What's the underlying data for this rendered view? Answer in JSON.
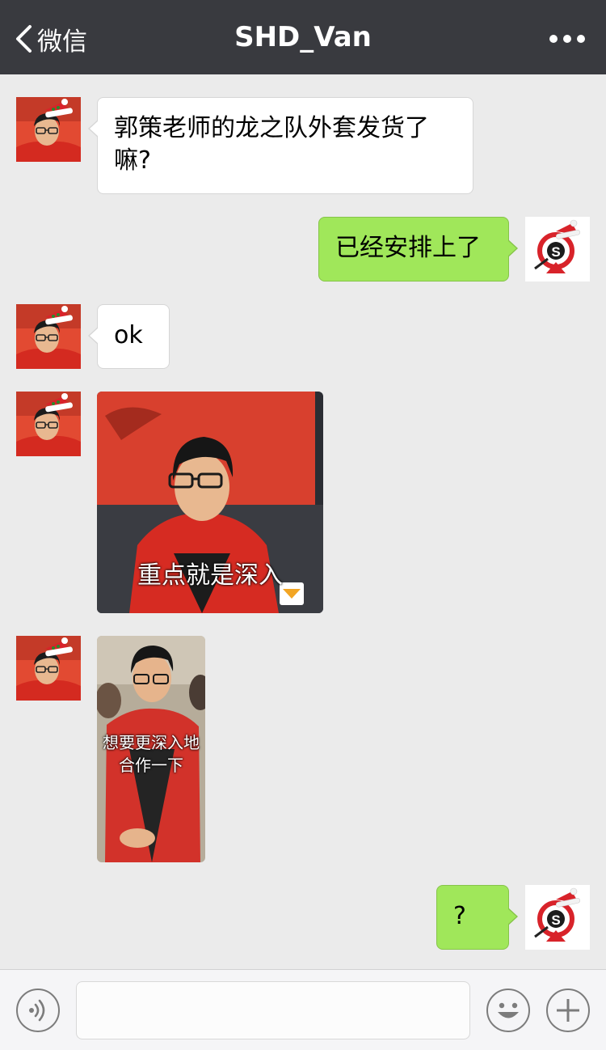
{
  "header": {
    "back_label": "微信",
    "title": "SHD_Van",
    "more_icon": "more-dots-icon"
  },
  "messages": [
    {
      "sender": "contact",
      "type": "text",
      "text": "郭策老师的龙之队外套发货了嘛?"
    },
    {
      "sender": "me",
      "type": "text",
      "text": "已经安排上了"
    },
    {
      "sender": "contact",
      "type": "text",
      "text": "ok"
    },
    {
      "sender": "contact",
      "type": "sticker",
      "caption": "重点就是深入"
    },
    {
      "sender": "contact",
      "type": "sticker",
      "caption_line1": "想要更深入地",
      "caption_line2": "合作一下"
    },
    {
      "sender": "me",
      "type": "text",
      "text": "?"
    }
  ],
  "input_bar": {
    "voice_icon": "voice-icon",
    "text_value": "",
    "emoji_icon": "emoji-icon",
    "plus_icon": "plus-icon"
  },
  "colors": {
    "navbar": "#393a3f",
    "background": "#ebebeb",
    "outgoing_bubble": "#a0e75a",
    "incoming_bubble": "#ffffff"
  }
}
